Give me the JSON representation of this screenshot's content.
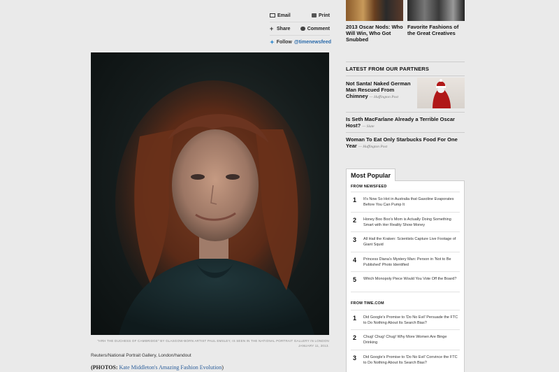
{
  "share": {
    "email": "Email",
    "print": "Print",
    "share": "Share",
    "comment": "Comment",
    "follow": "Follow",
    "handle": "@timenewsfeed"
  },
  "image": {
    "caption": "\"HRH THE DUCHESS OF CAMBRIDGE\" BY GLASGOW-BORN ARTIST PAUL EMSLEY, IS SEEN IN THE NATIONAL PORTRAIT GALLERY IN LONDON JANUARY 11, 2013.",
    "credit": "Reuters/National Portrait Gallery, London/handout",
    "photos_label": "(PHOTOS:",
    "photos_link": "Kate Middleton's Amazing Fashion Evolution",
    "photos_close": ")"
  },
  "top_stories": [
    {
      "title": "2013 Oscar Nods: Who Will Win, Who Got Snubbed"
    },
    {
      "title": "Favorite Fashions of the Great Creatives"
    }
  ],
  "partners": {
    "heading": "LATEST FROM OUR PARTNERS",
    "items": [
      {
        "title": "Not Santa! Naked German Man Rescued From Chimney",
        "source": "— Huffington Post"
      },
      {
        "title": "Is Seth MacFarlane Already a Terrible Oscar Host?",
        "source": "— Slate"
      },
      {
        "title": "Woman To Eat Only Starbucks Food For One Year",
        "source": "— Huffington Post"
      }
    ]
  },
  "most_popular": {
    "tab": "Most Popular",
    "section1": "FROM NEWSFEED",
    "newsfeed": [
      {
        "num": "1",
        "text": "It's Now So Hot in Australia that Gasoline Evaporates Before You Can Pump It"
      },
      {
        "num": "2",
        "text": "Honey Boo Boo's Mom is Actually Doing Something Smart with Her Reality Show Money"
      },
      {
        "num": "3",
        "text": "All Hail the Kraken: Scientists Capture Live Footage of Giant Squid"
      },
      {
        "num": "4",
        "text": "Princess Diana's Mystery Man: Person in 'Not to Be Published' Photo Identified"
      },
      {
        "num": "5",
        "text": "Which Monopoly Piece Would You Vote Off the Board?"
      }
    ],
    "section2": "FROM TIME.COM",
    "timecom": [
      {
        "num": "1",
        "text": "Did Google's Promise to 'Do No Evil' Persuade the FTC to Do Nothing About Its Search Bias?"
      },
      {
        "num": "2",
        "text": "Chug! Chug! Chug! Why More Women Are Binge Drinking"
      },
      {
        "num": "3",
        "text": "Did Google's Promise to 'Do No Evil' Convince the FTC to Do Nothing About Its Search Bias?"
      }
    ]
  }
}
